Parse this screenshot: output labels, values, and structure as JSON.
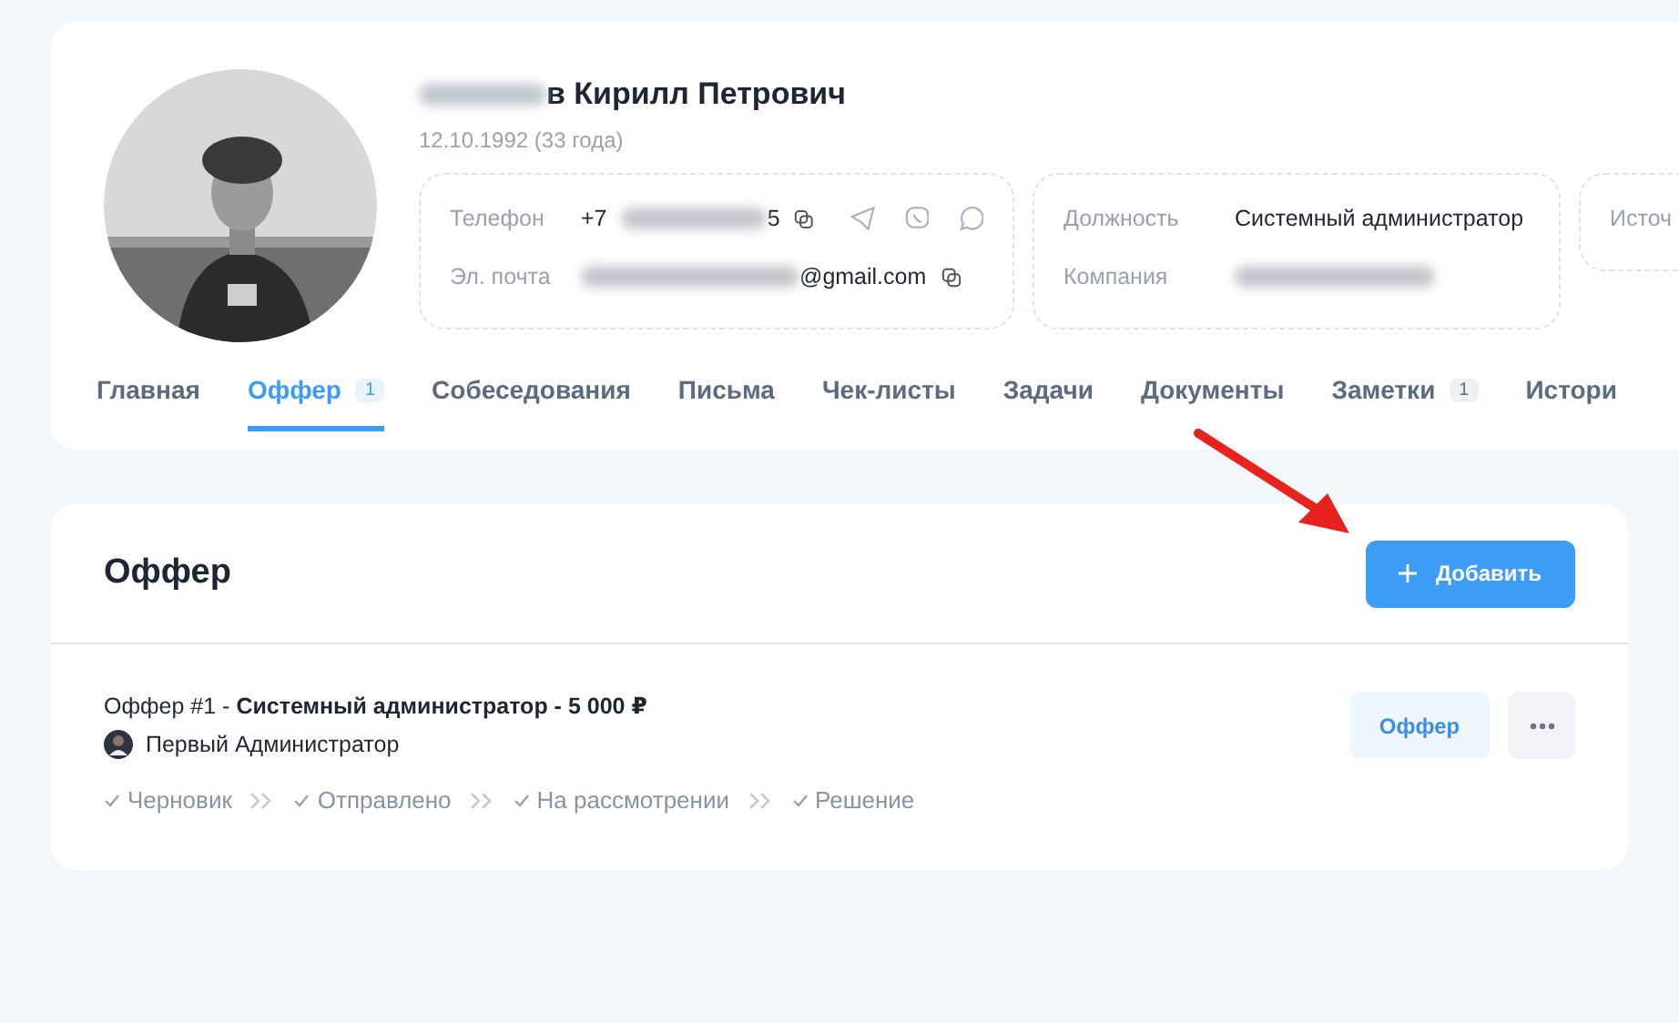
{
  "profile": {
    "name": "в Кирилл Петрович",
    "birth": "12.10.1992 (33 года)",
    "contacts": [
      {
        "label": "Телефон",
        "prefix": "+7",
        "suffix": "5",
        "kind": "phone"
      },
      {
        "label": "Эл. почта",
        "suffix": "@gmail.com",
        "kind": "email"
      }
    ],
    "job": [
      {
        "label": "Должность",
        "value": "Системный администратор"
      },
      {
        "label": "Компания"
      }
    ],
    "source_label": "Источ"
  },
  "tabs": [
    {
      "label": "Главная",
      "selected": false
    },
    {
      "label": "Оффер",
      "badge": "1",
      "selected": true
    },
    {
      "label": "Собеседования",
      "selected": false
    },
    {
      "label": "Письма",
      "selected": false
    },
    {
      "label": "Чек-листы",
      "selected": false
    },
    {
      "label": "Задачи",
      "selected": false
    },
    {
      "label": "Документы",
      "selected": false
    },
    {
      "label": "Заметки",
      "badge": "1",
      "selected": false
    },
    {
      "label": "Истори",
      "selected": false
    }
  ],
  "section": {
    "title": "Оффер",
    "add_button": "Добавить"
  },
  "offers": [
    {
      "title": "Оффер #1 - **Системный администратор - 5 000 ₽**",
      "author": "Первый Администратор",
      "button": "Оффер",
      "stages": [
        "Черновик",
        "Отправлено",
        "На рассмотрении",
        "Решение"
      ]
    }
  ]
}
